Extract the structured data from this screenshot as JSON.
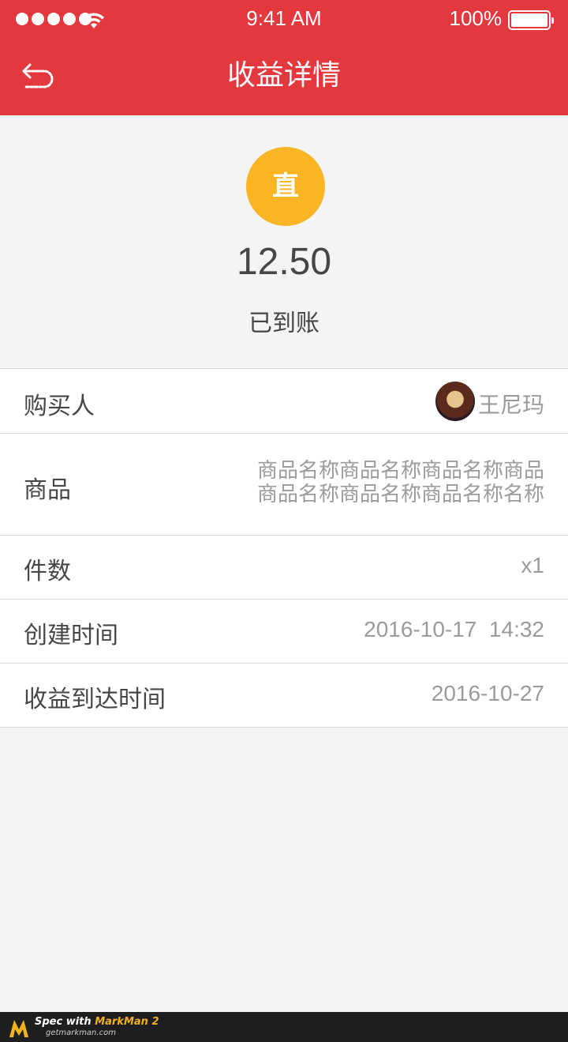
{
  "status_bar": {
    "time": "9:41 AM",
    "battery": "100%"
  },
  "header": {
    "title": "收益详情"
  },
  "hero": {
    "badge": "直",
    "amount": "12.50",
    "status": "已到账"
  },
  "rows": {
    "buyer": {
      "label": "购买人",
      "value": "王尼玛"
    },
    "goods": {
      "label": "商品",
      "value": "商品名称商品名称商品名称商品商品名称商品名称商品名称名称"
    },
    "quantity": {
      "label": "件数",
      "value": "x1"
    },
    "created": {
      "label": "创建时间",
      "value": "2016-10-17  14:32"
    },
    "arrival": {
      "label": "收益到达时间",
      "value": "2016-10-27"
    }
  },
  "footer": {
    "spec_prefix": "Spec with ",
    "spec_brand": "MarkMan 2",
    "site": "getmarkman.com"
  },
  "colors": {
    "header_bg": "#e4383f",
    "badge_bg": "#fbb423",
    "primary_text": "#464646",
    "secondary_text": "#9b9b9b",
    "page_bg": "#f4f4f4"
  },
  "icons": {
    "back": "back-arrow-icon",
    "signal": "signal-dots-icon",
    "wifi": "wifi-icon",
    "battery": "battery-icon",
    "avatar": "avatar"
  }
}
